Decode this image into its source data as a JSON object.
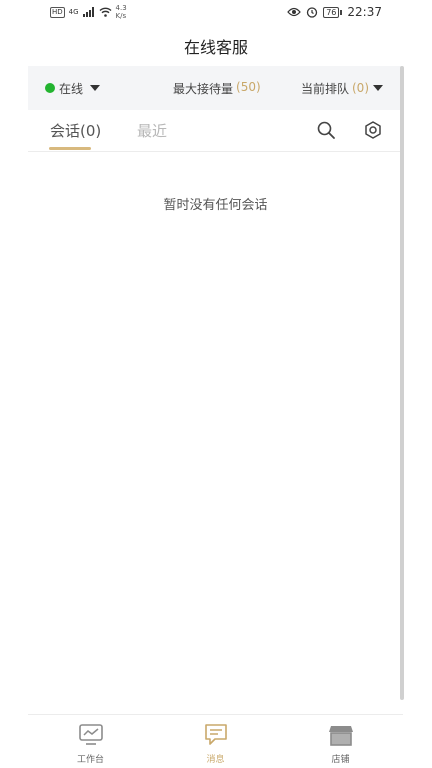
{
  "statusbar": {
    "hd_badge": "HD",
    "net_type": "4G",
    "speed_value": "4.3",
    "speed_unit": "K/s",
    "battery": "76",
    "time": "22:37"
  },
  "header": {
    "title": "在线客服"
  },
  "topbar": {
    "status_label": "在线",
    "status_color": "#23b430",
    "max_receive_label": "最大接待量",
    "max_receive_value": "(50)",
    "queue_label": "当前排队",
    "queue_value": "(0)"
  },
  "tabs": {
    "sessions_label": "会话(0)",
    "recent_label": "最近"
  },
  "main": {
    "empty_message": "暂时没有任何会话"
  },
  "bottom_nav": {
    "items": [
      {
        "label": "工作台",
        "icon": "monitor-icon"
      },
      {
        "label": "消息",
        "icon": "message-icon"
      },
      {
        "label": "店铺",
        "icon": "store-icon"
      }
    ],
    "active_index": 1,
    "active_color": "#c9a86a"
  }
}
